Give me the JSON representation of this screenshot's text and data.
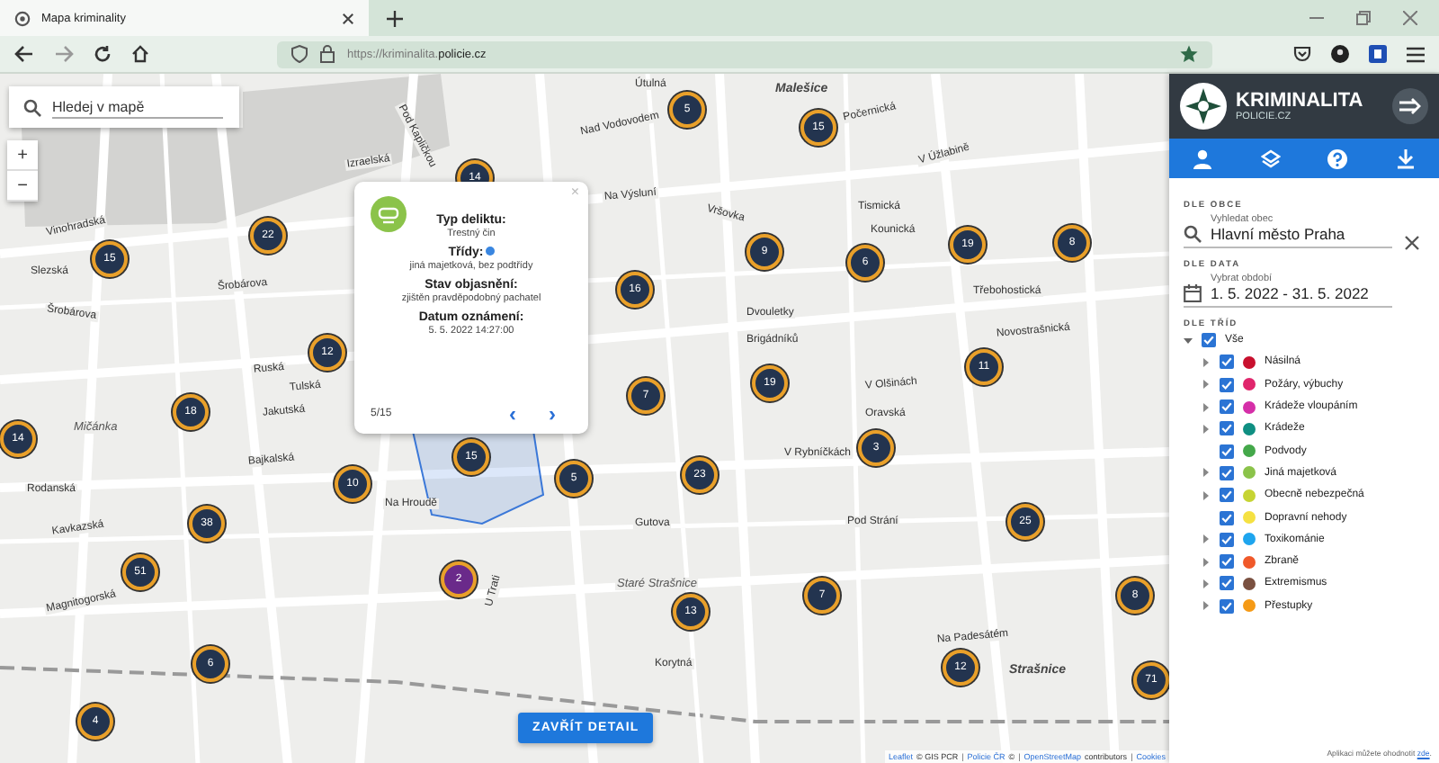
{
  "browser": {
    "tab_title": "Mapa kriminality",
    "url_host": "https://kriminalita.",
    "url_domain": "policie.cz"
  },
  "map": {
    "search": {
      "placeholder": "Hledej v mapě"
    },
    "zoom_in": "+",
    "zoom_out": "−",
    "street_labels": [
      "Malešice",
      "Útulná",
      "Počernická",
      "Nad Vodovodem",
      "Pod Kapličkou",
      "Izraelská",
      "Vinohradská",
      "Slezská",
      "Šrobárova",
      "Šrobárova",
      "Ruská",
      "Tulská",
      "Jakutská",
      "Bajkalská",
      "Kavkazská",
      "Mičánka",
      "Na Hroudě",
      "U Trati",
      "Dvouletky",
      "Brigádníků",
      "V Olšinách",
      "Gutova",
      "Oravská",
      "Pod Strání",
      "V Rybníčkách",
      "Strašnice",
      "Staré Strašnice",
      "Korytná",
      "Na Padesátém",
      "Třebohostická",
      "Novostrašnická",
      "V Úžlabině",
      "Na Výsluní",
      "Vršovka",
      "Tismická",
      "Kounická",
      "Magnitogorská",
      "Rodanská"
    ],
    "clusters": [
      {
        "count": "5"
      },
      {
        "count": "15"
      },
      {
        "count": "14"
      },
      {
        "count": "22"
      },
      {
        "count": "15"
      },
      {
        "count": "19"
      },
      {
        "count": "8"
      },
      {
        "count": "9"
      },
      {
        "count": "6"
      },
      {
        "count": "16"
      },
      {
        "count": "12"
      },
      {
        "count": "11"
      },
      {
        "count": "7"
      },
      {
        "count": "19"
      },
      {
        "count": "18"
      },
      {
        "count": "14"
      },
      {
        "count": "15"
      },
      {
        "count": "3"
      },
      {
        "count": "10"
      },
      {
        "count": "5"
      },
      {
        "count": "23"
      },
      {
        "count": "38"
      },
      {
        "count": "25"
      },
      {
        "count": "51"
      },
      {
        "count": "2"
      },
      {
        "count": "13"
      },
      {
        "count": "7"
      },
      {
        "count": "8"
      },
      {
        "count": "6"
      },
      {
        "count": "12"
      },
      {
        "count": "71"
      },
      {
        "count": "4"
      }
    ],
    "popup": {
      "close": "×",
      "fields": [
        {
          "label": "Typ deliktu:",
          "value": "Trestný čin",
          "info": false
        },
        {
          "label": "Třídy:",
          "value": "jiná majetková, bez podtřídy",
          "info": true
        },
        {
          "label": "Stav objasnění:",
          "value": "zjištěn pravděpodobný pachatel",
          "info": false
        },
        {
          "label": "Datum oznámení:",
          "value": "5. 5. 2022 14:27:00",
          "info": false
        }
      ],
      "pager": "5/15",
      "prev": "‹",
      "next": "›"
    },
    "close_detail_button": "ZAVŘÍT DETAIL",
    "attribution_separator": "|",
    "attribution": [
      {
        "text": "Leaflet",
        "link": true
      },
      {
        "text": "© GIS PCR",
        "link": false
      },
      {
        "text": "Policie ČR",
        "link": true
      },
      {
        "text": "©",
        "link": false
      },
      {
        "text": "OpenStreetMap",
        "link": true
      },
      {
        "text": "contributors",
        "link": false
      },
      {
        "text": "Cookies",
        "link": true
      }
    ]
  },
  "sidebar": {
    "brand": "KRIMINALITA",
    "brand_sub": "POLICIE.CZ",
    "municipality": {
      "heading": "DLE OBCE",
      "label": "Vyhledat obec",
      "value": "Hlavní město Praha"
    },
    "date": {
      "heading": "DLE DATA",
      "label": "Vybrat období",
      "value": "1. 5. 2022 - 31. 5. 2022"
    },
    "classes": {
      "heading": "DLE TŘÍD",
      "root": {
        "label": "Vše",
        "checked": true,
        "expanded": true,
        "children": [
          {
            "label": "Násilná",
            "color": "#c8102e",
            "checked": true,
            "kind": "group"
          },
          {
            "label": "Požáry, výbuchy",
            "color": "#e0266c",
            "checked": true,
            "kind": "group"
          },
          {
            "label": "Krádeže vloupáním",
            "color": "#d52fa8",
            "checked": true,
            "kind": "group"
          },
          {
            "label": "Krádeže",
            "color": "#0f8f82",
            "checked": true,
            "kind": "group"
          },
          {
            "label": "Podvody",
            "color": "#44a84a",
            "checked": true,
            "kind": "leaf"
          },
          {
            "label": "Jiná majetková",
            "color": "#8bc34a",
            "checked": true,
            "kind": "group"
          },
          {
            "label": "Obecně nebezpečná",
            "color": "#c6d433",
            "checked": true,
            "kind": "group"
          },
          {
            "label": "Dopravní nehody",
            "color": "#f5e142",
            "checked": true,
            "kind": "leaf"
          },
          {
            "label": "Toxikománie",
            "color": "#1ea5ee",
            "checked": true,
            "kind": "group"
          },
          {
            "label": "Zbraně",
            "color": "#f0592a",
            "checked": true,
            "kind": "group"
          },
          {
            "label": "Extremismus",
            "color": "#7a5040",
            "checked": true,
            "kind": "group"
          },
          {
            "label": "Přestupky",
            "color": "#f59a16",
            "checked": true,
            "kind": "group"
          }
        ]
      }
    },
    "footer": {
      "text": "Aplikaci můžete ohodnotit",
      "link": "zde",
      "end": "."
    }
  }
}
